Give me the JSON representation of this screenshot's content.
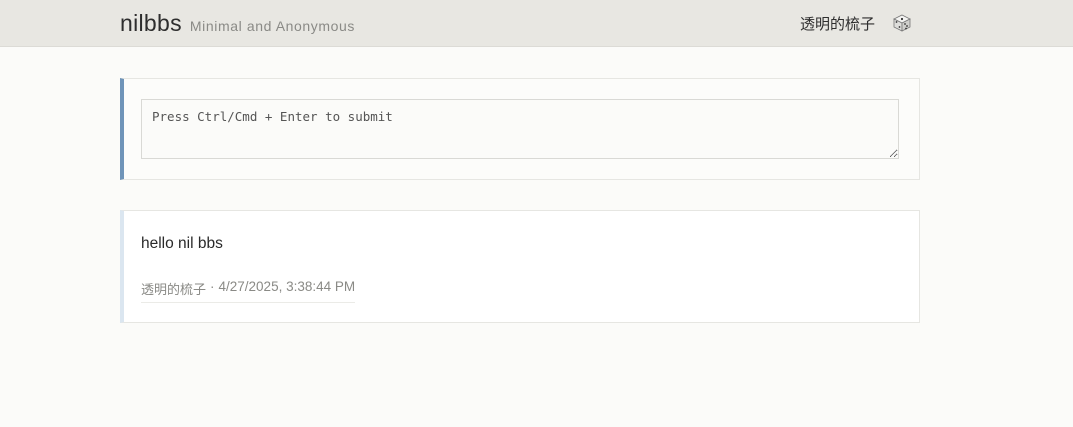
{
  "header": {
    "brand": "nilbbs",
    "tagline": "Minimal and Anonymous",
    "username": "透明的梳子",
    "dice_icon": "dice-icon"
  },
  "compose": {
    "placeholder": "Press Ctrl/Cmd + Enter to submit",
    "value": "",
    "accent_color": "#6f94b8"
  },
  "posts": [
    {
      "content": "hello nil bbs",
      "author": "透明的梳子",
      "separator": "·",
      "timestamp": "4/27/2025, 3:38:44 PM"
    }
  ]
}
